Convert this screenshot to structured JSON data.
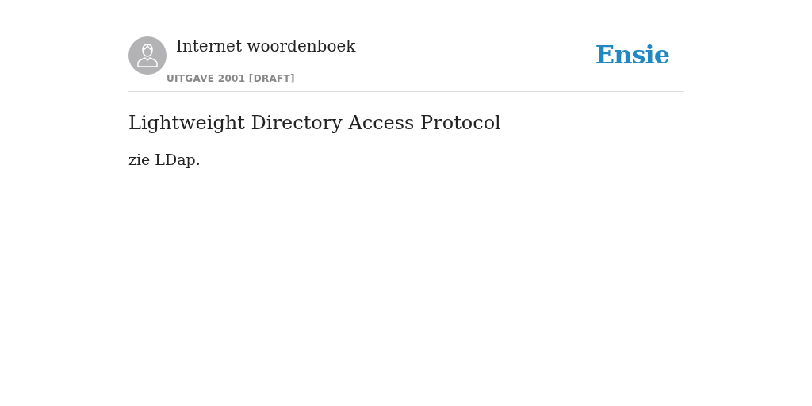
{
  "header": {
    "title": "Internet woordenboek",
    "edition": "UITGAVE 2001 [DRAFT]",
    "logo": "Ensie"
  },
  "entry": {
    "term": "Lightweight Directory Access Protocol",
    "definition": "zie LDap."
  }
}
